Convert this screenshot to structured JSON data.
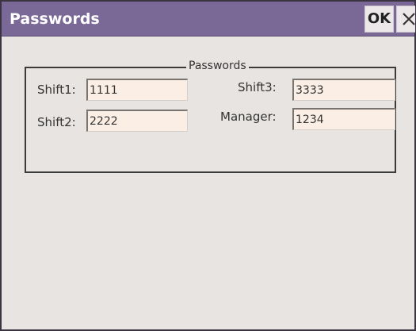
{
  "window": {
    "title": "Passwords",
    "ok_label": "OK"
  },
  "group": {
    "legend": "Passwords"
  },
  "fields": {
    "shift1": {
      "label": "Shift1:",
      "value": "1111"
    },
    "shift2": {
      "label": "Shift2:",
      "value": "2222"
    },
    "shift3": {
      "label": "Shift3:",
      "value": "3333"
    },
    "manager": {
      "label": "Manager:",
      "value": "1234"
    }
  },
  "icons": {
    "close": "close-icon"
  },
  "colors": {
    "titlebar": "#7a6896",
    "window_bg": "#e7e4e2",
    "field_bg": "#fbeee4"
  }
}
